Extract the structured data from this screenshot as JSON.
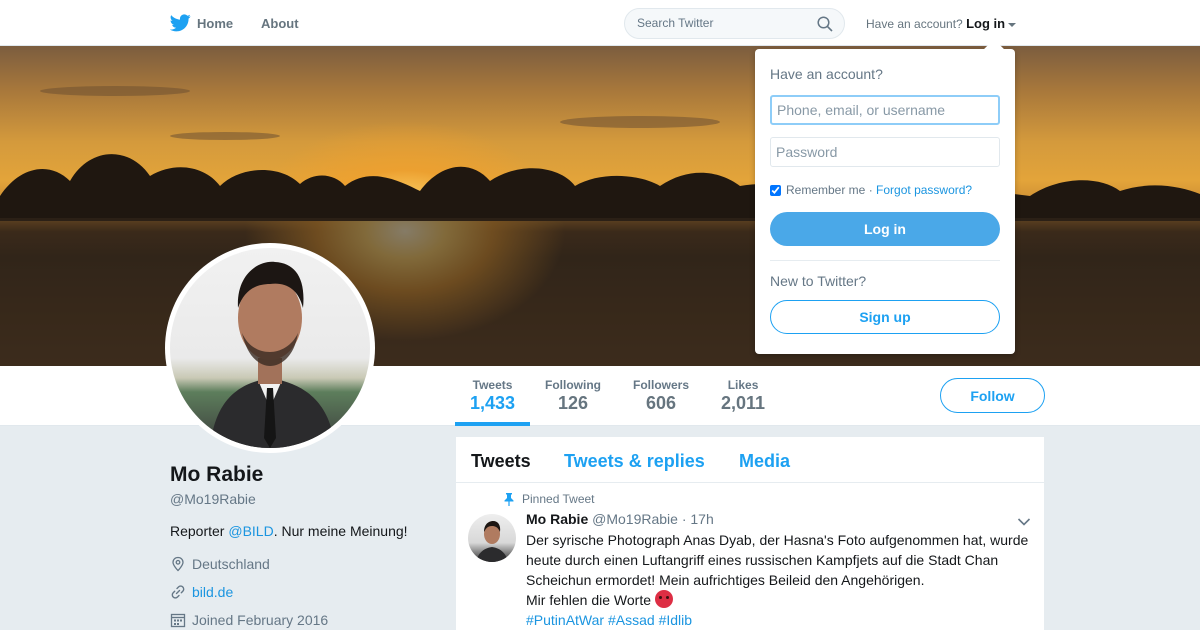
{
  "nav": {
    "home_label": "Home",
    "about_label": "About",
    "search_placeholder": "Search Twitter",
    "account_prompt": "Have an account?",
    "login_label": "Log in"
  },
  "login_dropdown": {
    "title": "Have an account?",
    "username_placeholder": "Phone, email, or username",
    "password_placeholder": "Password",
    "remember_me": "Remember me",
    "separator": "·",
    "forgot_password": "Forgot password?",
    "login_button": "Log in",
    "new_prompt": "New to Twitter?",
    "signup_button": "Sign up"
  },
  "stats": [
    {
      "label": "Tweets",
      "value": "1,433"
    },
    {
      "label": "Following",
      "value": "126"
    },
    {
      "label": "Followers",
      "value": "606"
    },
    {
      "label": "Likes",
      "value": "2,011"
    }
  ],
  "follow_button": "Follow",
  "profile": {
    "name": "Mo Rabie",
    "handle": "@Mo19Rabie",
    "bio_prefix": "Reporter ",
    "bio_mention": "@BILD",
    "bio_suffix": ". Nur meine Meinung!",
    "location": "Deutschland",
    "website": "bild.de",
    "joined": "Joined February 2016"
  },
  "timeline": {
    "tabs": [
      "Tweets",
      "Tweets & replies",
      "Media"
    ],
    "pinned_label": "Pinned Tweet",
    "tweet": {
      "author": "Mo Rabie",
      "handle": "@Mo19Rabie",
      "time": "· 17h",
      "text": "Der syrische Photograph Anas Dyab, der Hasna's Foto aufgenommen hat, wurde heute durch einen Luftangriff eines russischen Kampfjets auf die Stadt Chan Scheichun ermordet! Mein aufrichtiges Beileid den Angehörigen.",
      "text_line2": "Mir fehlen die Worte",
      "hashtags": [
        "#PutinAtWar",
        "#Assad",
        "#Idlib"
      ]
    }
  },
  "colors": {
    "accent": "#1da1f2",
    "link": "#1b95e0",
    "login_button": "#4aa8e8"
  }
}
